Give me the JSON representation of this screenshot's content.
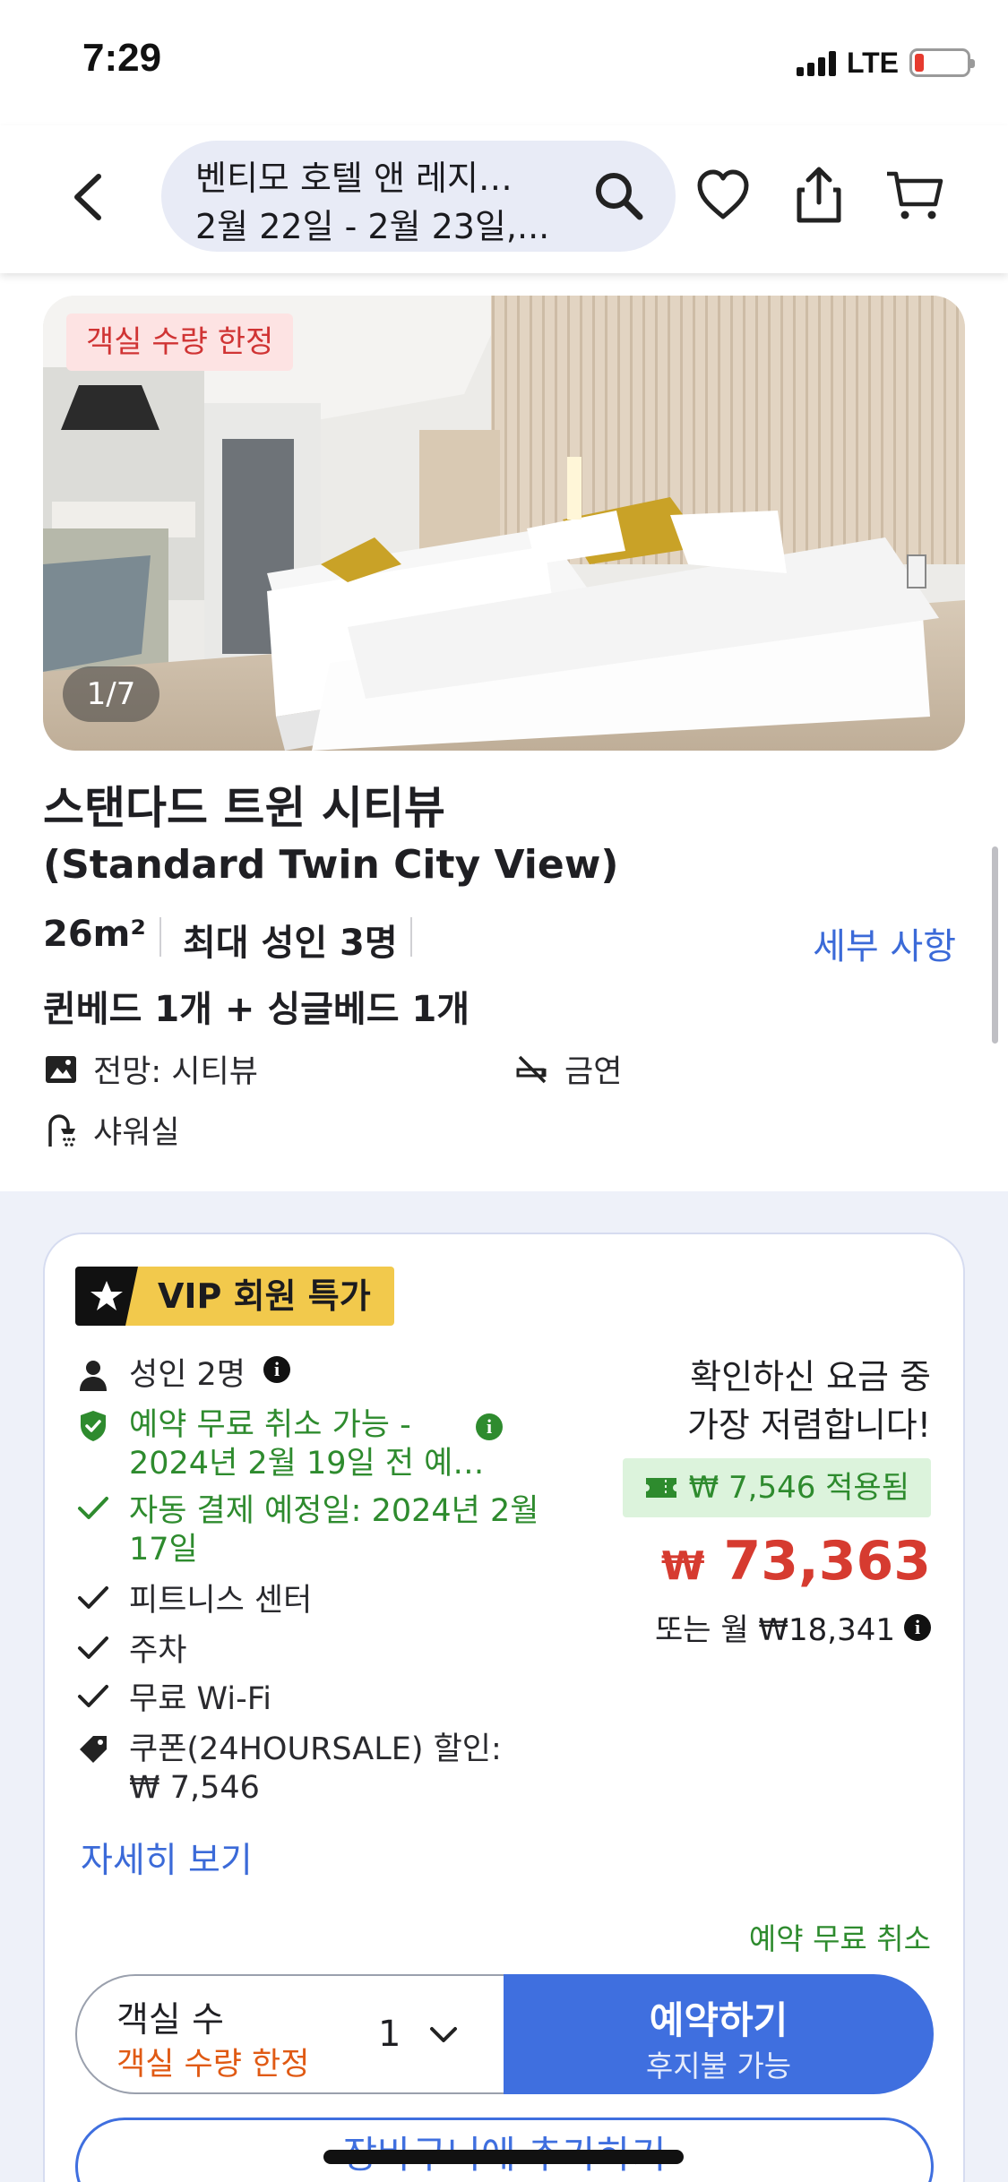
{
  "status_bar": {
    "time": "7:29",
    "network": "LTE"
  },
  "header": {
    "search_line1": "벤티모 호텔 앤 레지…",
    "search_line2": "2월 22일 - 2월 23일,..."
  },
  "room": {
    "limited_badge": "객실 수량 한정",
    "image_counter": "1/7",
    "title_ko": "스탠다드 트윈 시티뷰",
    "title_en": "(Standard Twin City View)",
    "size": "26m²",
    "capacity": "최대 성인 3명",
    "details_link": "세부 사항",
    "beds": "퀸베드 1개 + 싱글베드 1개",
    "features": {
      "view": "전망: 시티뷰",
      "smoking": "금연",
      "shower": "샤워실"
    }
  },
  "offer": {
    "vip_label": "VIP 회원 특가",
    "guests": "성인 2명",
    "free_cancel_line1": "예약 무료 취소 가능 -",
    "free_cancel_line2": "2024년 2월 19일 전 예…",
    "autopay_line1": "자동 결제 예정일: 2024년 2월",
    "autopay_line2": "17일",
    "amenity_fitness": "피트니스 센터",
    "amenity_parking": "주차",
    "amenity_wifi": "무료 Wi-Fi",
    "coupon_line1": "쿠폰(24HOURSALE) 할인:",
    "coupon_line2": "₩ 7,546",
    "price_note_line1": "확인하신 요금 중",
    "price_note_line2": "가장 저렴합니다!",
    "coupon_applied": "₩ 7,546 적용됨",
    "price_currency": "₩",
    "price_value": "73,363",
    "monthly": "또는 월 ₩18,341",
    "more_link": "자세히 보기",
    "free_cancel_tag": "예약 무료 취소",
    "room_count_label": "객실 수",
    "room_count_sub": "객실 수량 한정",
    "room_count_value": "1",
    "book_label": "예약하기",
    "book_sub": "후지불 가능",
    "cart_button": "장바구니에 추가하기"
  },
  "colors": {
    "accent": "#3f6fdf",
    "price": "#d63b30",
    "green": "#2e8b2e",
    "vip": "#f2c94c"
  }
}
